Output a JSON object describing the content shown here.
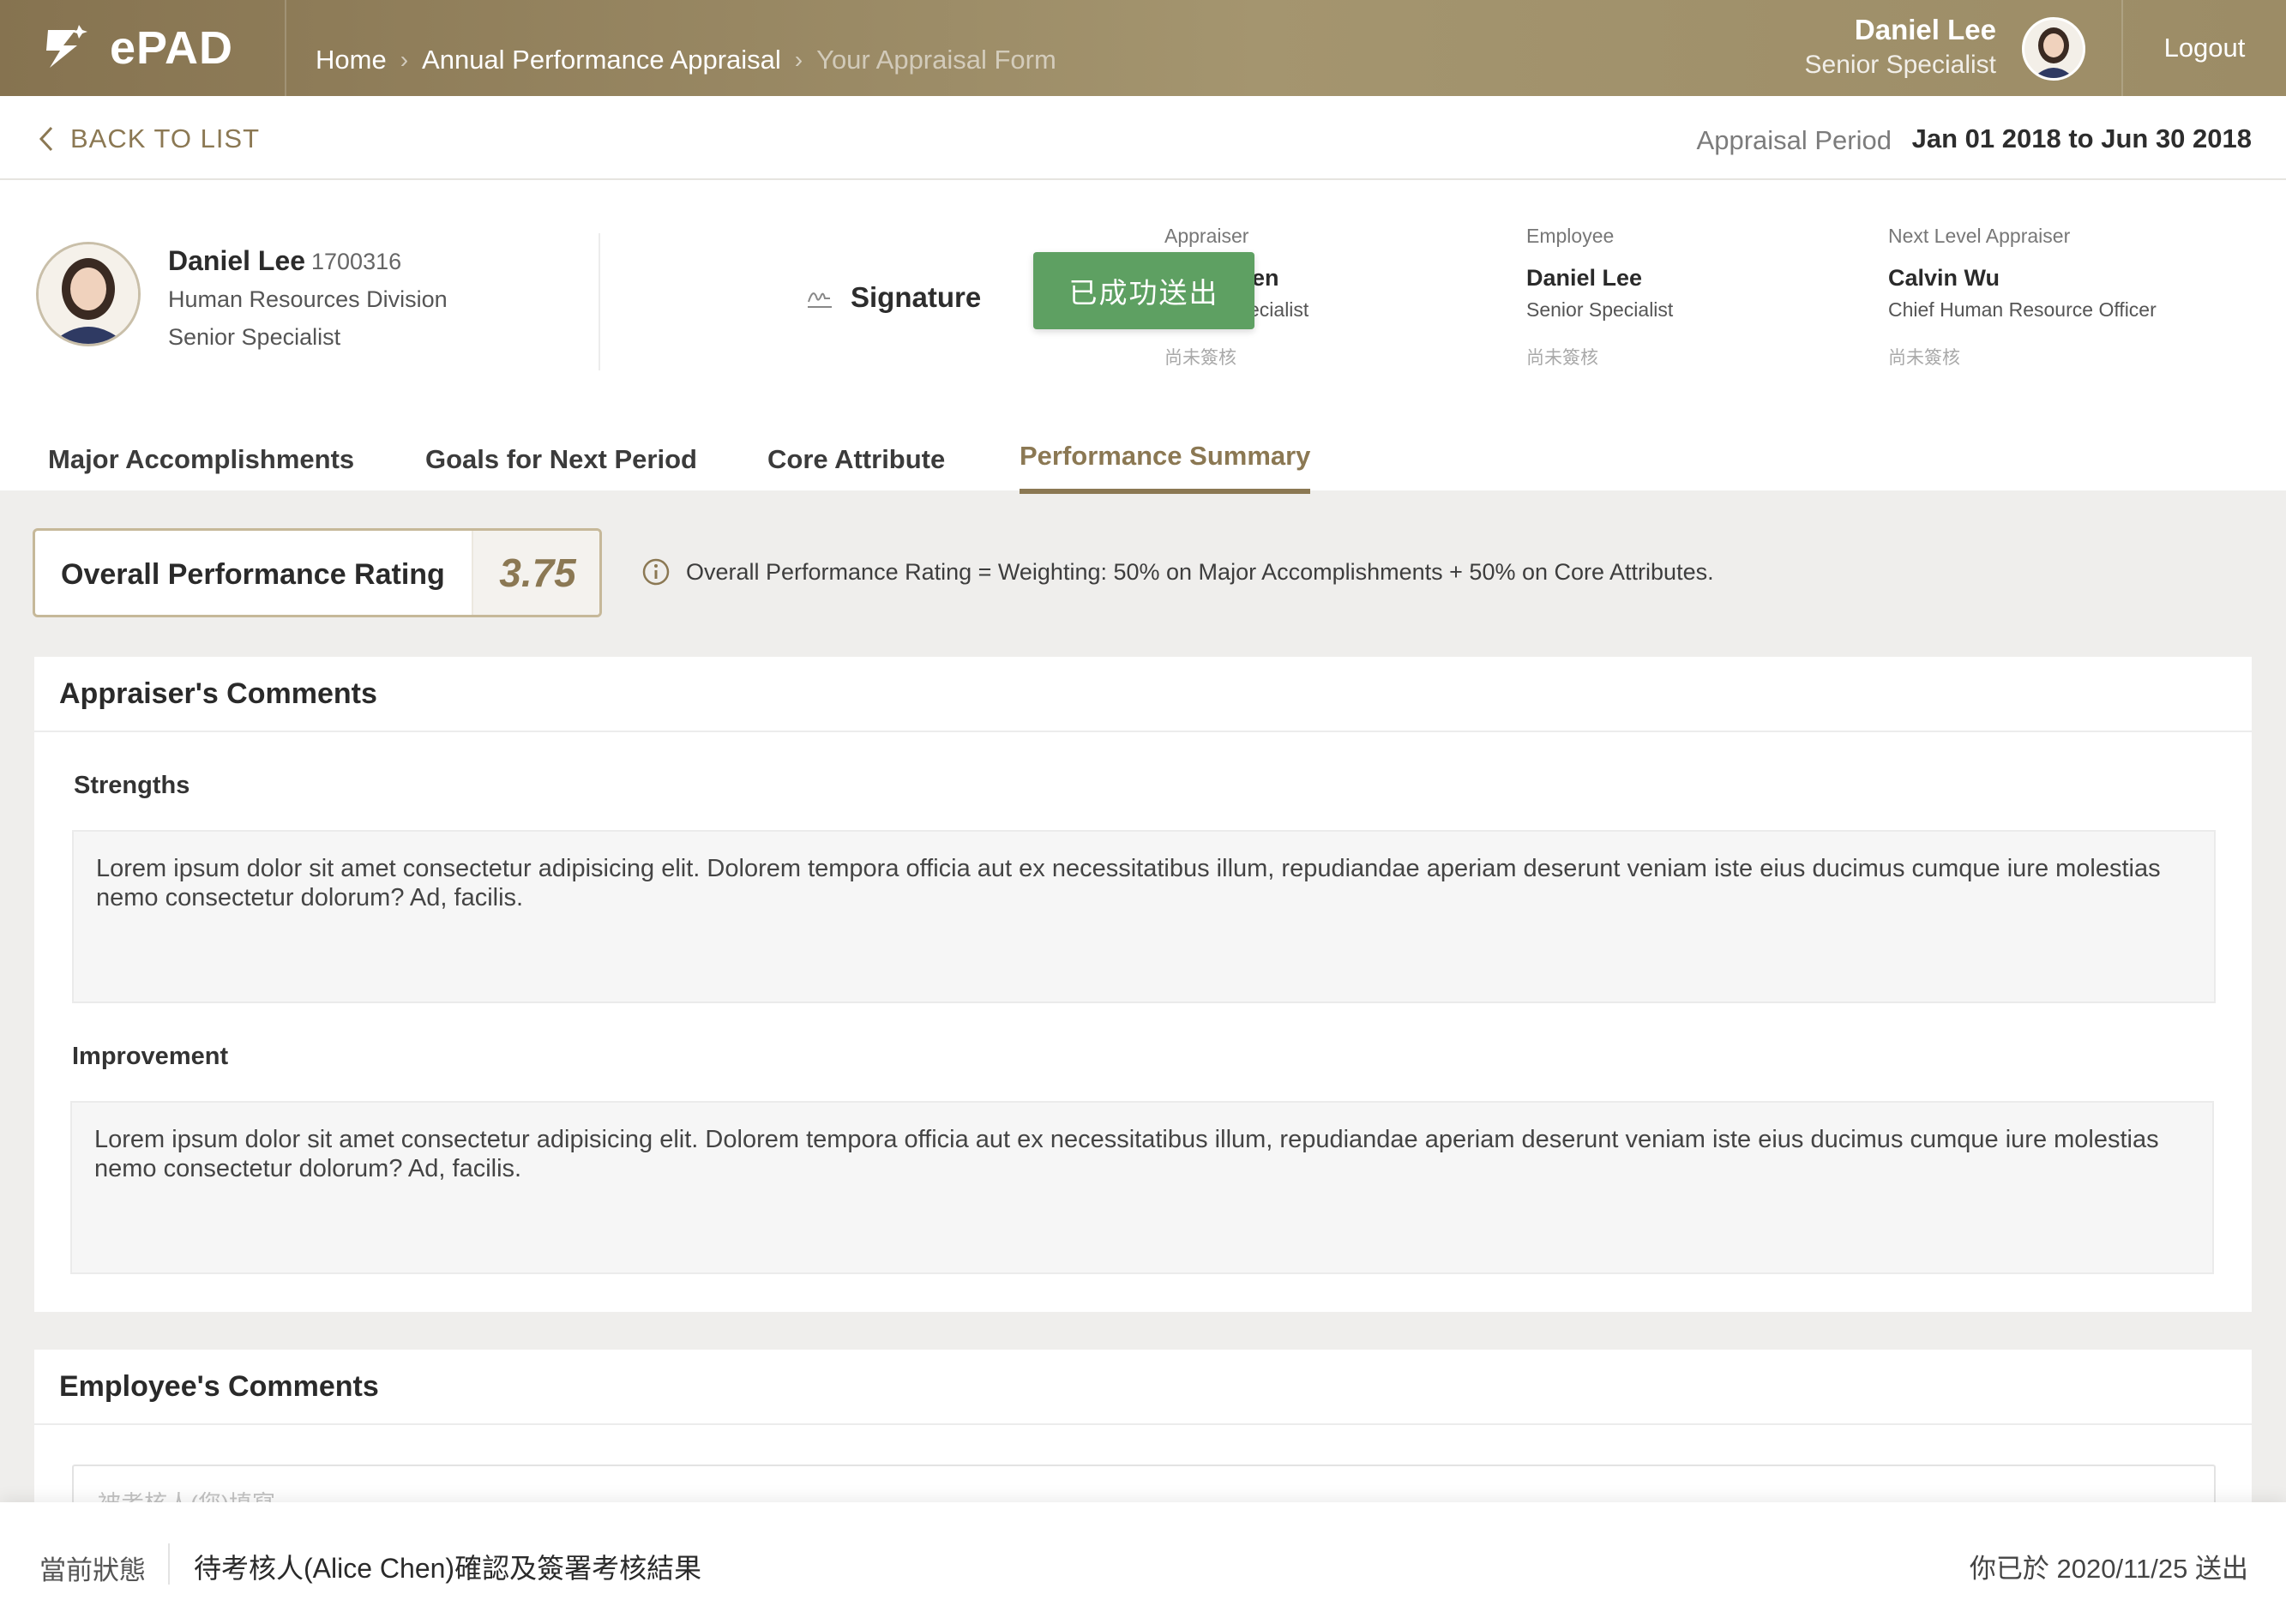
{
  "header": {
    "brand": "ePAD",
    "breadcrumb": [
      "Home",
      "Annual Performance Appraisal",
      "Your Appraisal Form"
    ],
    "user_name": "Daniel Lee",
    "user_title": "Senior Specialist",
    "logout_label": "Logout",
    "colors": {
      "bar_start": "#867350",
      "bar_end": "#a4956f",
      "accent": "#8b7853"
    }
  },
  "subheader": {
    "back_label": "BACK TO LIST",
    "period_label": "Appraisal Period",
    "period_value": "Jan 01 2018 to Jun 30 2018"
  },
  "employee": {
    "name": "Daniel Lee",
    "id": "1700316",
    "division": "Human Resources Division",
    "title": "Senior Specialist"
  },
  "signature": {
    "label": "Signature",
    "signers": [
      {
        "role": "Appraiser",
        "name": "en",
        "title": "ecialist",
        "status": "尚未簽核"
      },
      {
        "role": "Employee",
        "name": "Daniel Lee",
        "title": "Senior Specialist",
        "status": "尚未簽核"
      },
      {
        "role": "Next Level Appraiser",
        "name": "Calvin Wu",
        "title": "Chief Human Resource Officer",
        "status": "尚未簽核"
      }
    ]
  },
  "toast": {
    "text": "已成功送出",
    "color": "#5ea062"
  },
  "tabs": [
    {
      "label": "Major Accomplishments",
      "active": false
    },
    {
      "label": "Goals for Next Period",
      "active": false
    },
    {
      "label": "Core Attribute",
      "active": false
    },
    {
      "label": "Performance Summary",
      "active": true
    }
  ],
  "rating": {
    "label": "Overall Performance Rating",
    "value": "3.75",
    "note": "Overall Performance Rating = Weighting: 50% on Major Accomplishments + 50% on Core Attributes."
  },
  "appraiser_comments": {
    "title": "Appraiser's Comments",
    "strengths_label": "Strengths",
    "strengths_text": "Lorem ipsum dolor sit amet consectetur adipisicing elit. Dolorem tempora officia aut ex necessitatibus illum, repudiandae aperiam deserunt veniam iste eius ducimus cumque iure molestias nemo consectetur dolorum? Ad, facilis.",
    "improvement_label": "Improvement",
    "improvement_text": "Lorem ipsum dolor sit amet consectetur adipisicing elit. Dolorem tempora officia aut ex necessitatibus illum, repudiandae aperiam deserunt veniam iste eius ducimus cumque iure molestias nemo consectetur dolorum? Ad, facilis."
  },
  "employee_comments": {
    "title": "Employee's Comments",
    "placeholder": "被考核人(您)填寫"
  },
  "status": {
    "label": "當前狀態",
    "text": "待考核人(Alice Chen)確認及簽署考核結果",
    "sent": "你已於 2020/11/25 送出"
  }
}
